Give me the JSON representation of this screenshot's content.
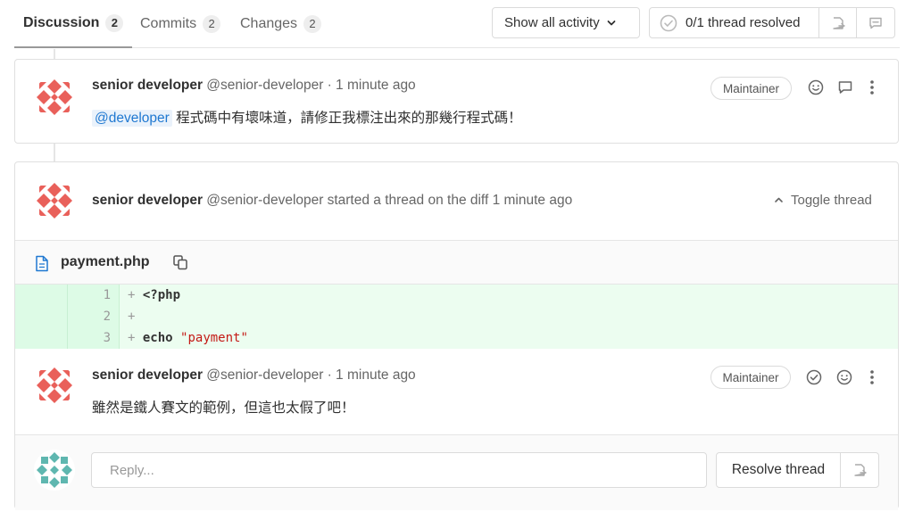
{
  "tabs": [
    {
      "label": "Discussion",
      "count": "2"
    },
    {
      "label": "Commits",
      "count": "2"
    },
    {
      "label": "Changes",
      "count": "2"
    }
  ],
  "activity_filter": {
    "label": "Show all activity"
  },
  "threads_resolved": {
    "label": "0/1 thread resolved"
  },
  "notes": [
    {
      "author": "senior developer",
      "handle": "@senior-developer",
      "meta": "· 1 minute ago",
      "role": "Maintainer",
      "mention": "@developer",
      "body": "程式碼中有壞味道，請修正我標注出來的那幾行程式碼！"
    }
  ],
  "thread": {
    "author": "senior developer",
    "handle": "@senior-developer",
    "meta": "started a thread on the diff 1 minute ago",
    "toggle_label": "Toggle thread",
    "file_name": "payment.php",
    "diff_lines": [
      {
        "num": "1",
        "sign": "+",
        "text": "<?php"
      },
      {
        "num": "2",
        "sign": "+",
        "text": ""
      },
      {
        "num": "3",
        "sign": "+",
        "keyword": "echo",
        "string": "\"payment\""
      }
    ],
    "reply_note": {
      "author": "senior developer",
      "handle": "@senior-developer",
      "meta": "· 1 minute ago",
      "role": "Maintainer",
      "body": "雖然是鐵人賽文的範例，但這也太假了吧！"
    },
    "reply_placeholder": "Reply...",
    "resolve_label": "Resolve thread"
  },
  "colors": {
    "accent": "#1f78d1",
    "diff_added": "#ecfdf0",
    "avatar": "#e9605a",
    "avatar_user": "#5fb7b0"
  }
}
